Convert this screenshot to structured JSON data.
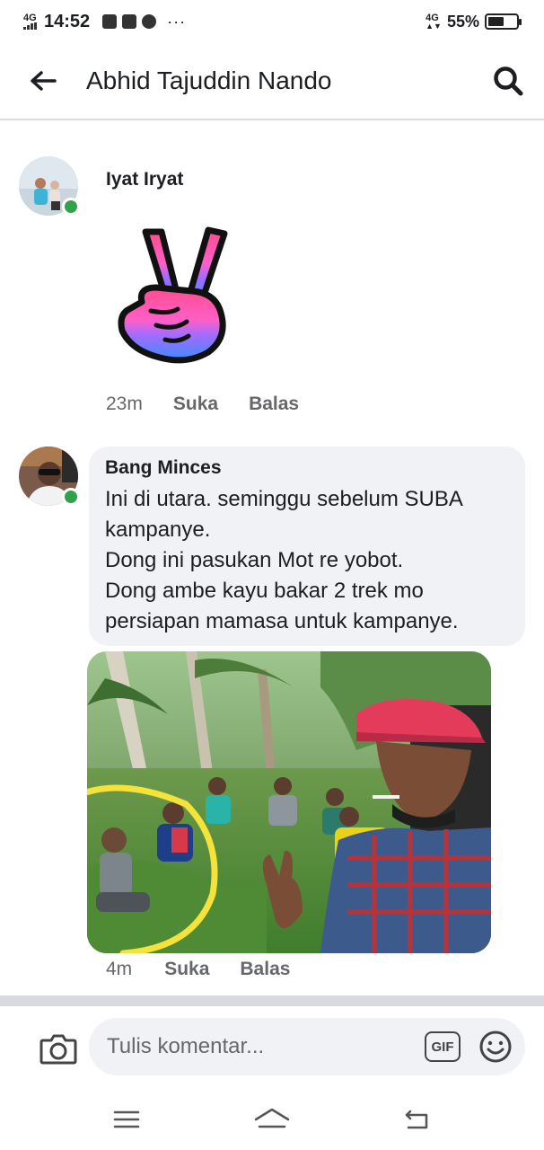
{
  "status_bar": {
    "network_left": "4G",
    "time": "14:52",
    "more": "···",
    "network_right": "4G",
    "battery": "55%",
    "battery_level": 0.55
  },
  "header": {
    "title": "Abhid Tajuddin Nando"
  },
  "comments": [
    {
      "author": "Iyat Iryat",
      "sticker": "peace-hand-sticker",
      "time": "23m",
      "like_label": "Suka",
      "reply_label": "Balas"
    },
    {
      "author": "Bang Minces",
      "text": "Ini di utara. seminggu sebelum SUBA kampanye.\nDong ini pasukan Mot re yobot.\nDong ambe kayu bakar 2 trek mo persiapan mamasa untuk kampanye.",
      "time": "4m",
      "like_label": "Suka",
      "reply_label": "Balas"
    }
  ],
  "composer": {
    "placeholder": "Tulis komentar...",
    "gif_label": "GIF"
  },
  "colors": {
    "online": "#31a24c",
    "bubble": "#f0f2f5",
    "meta": "#65676b",
    "annotation": "#f5e23a"
  }
}
